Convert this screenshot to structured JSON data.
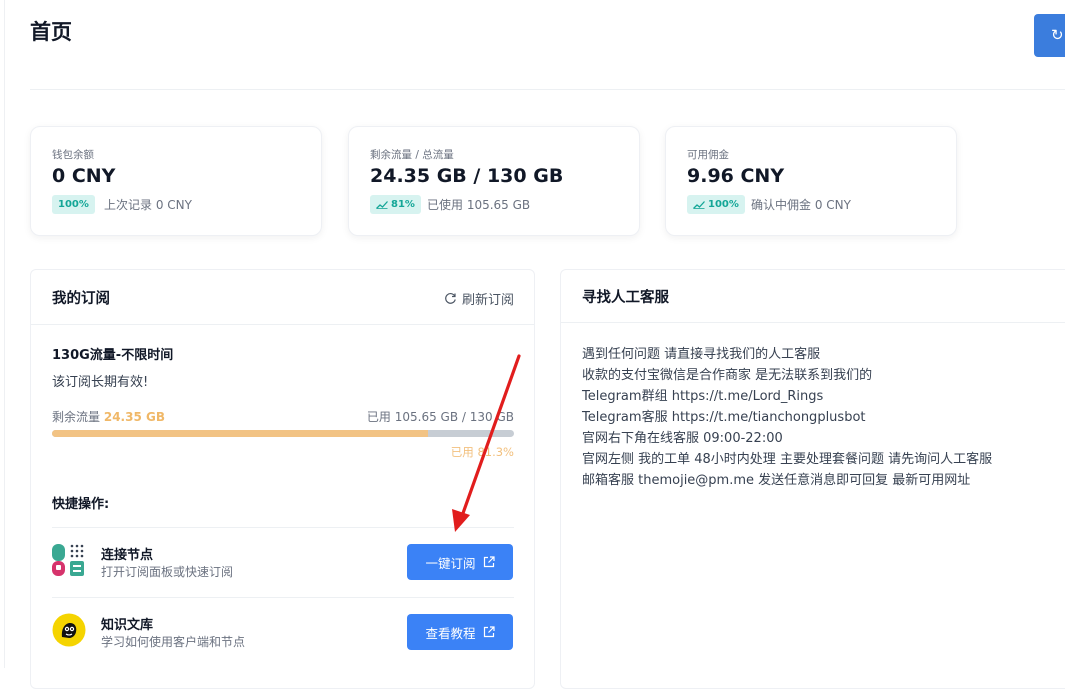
{
  "page": {
    "title": "首页"
  },
  "stats": [
    {
      "label": "钱包余额",
      "value": "0 CNY",
      "badge": "100%",
      "badge_icon": "",
      "sub": "上次记录 0 CNY"
    },
    {
      "label": "剩余流量 / 总流量",
      "value": "24.35 GB / 130 GB",
      "badge": "81%",
      "badge_icon": "trend-up-icon",
      "sub": "已使用 105.65 GB"
    },
    {
      "label": "可用佣金",
      "value": "9.96 CNY",
      "badge": "100%",
      "badge_icon": "trend-up-icon",
      "sub": "确认中佣金 0 CNY"
    }
  ],
  "subscription": {
    "title": "我的订阅",
    "refresh_label": "刷新订阅",
    "plan_name": "130G流量-不限时间",
    "status": "该订阅长期有效!",
    "remaining_label": "剩余流量",
    "remaining_value": "24.35 GB",
    "used_label": "已用 105.65 GB / 130 GB",
    "used_fraction": 0.813,
    "used_percent_label": "已用 81.3%",
    "quick_actions_title": "快捷操作:",
    "actions": [
      {
        "title": "连接节点",
        "desc": "打开订阅面板或快速订阅",
        "button": "一键订阅",
        "icon": "app-grid-icon"
      },
      {
        "title": "知识文库",
        "desc": "学习如何使用客户端和节点",
        "button": "查看教程",
        "icon": "mascot-icon"
      }
    ]
  },
  "support": {
    "title": "寻找人工客服",
    "lines": [
      "遇到任何问题 请直接寻找我们的人工客服",
      "收款的支付宝微信是合作商家 是无法联系到我们的",
      "Telegram群组 https://t.me/Lord_Rings",
      "Telegram客服 https://t.me/tianchongplusbot",
      "官网右下角在线客服 09:00-22:00",
      "官网左侧 我的工单 48小时内处理 主要处理套餐问题 请先询问人工客服",
      "邮箱客服 themojie@pm.me 发送任意消息即可回复 最新可用网址"
    ]
  },
  "colors": {
    "accent": "#3b82f6",
    "badge_bg": "#d7f3f0",
    "badge_text": "#14a697",
    "progress": "#f2c384",
    "annotation_arrow": "#e11d1d"
  }
}
